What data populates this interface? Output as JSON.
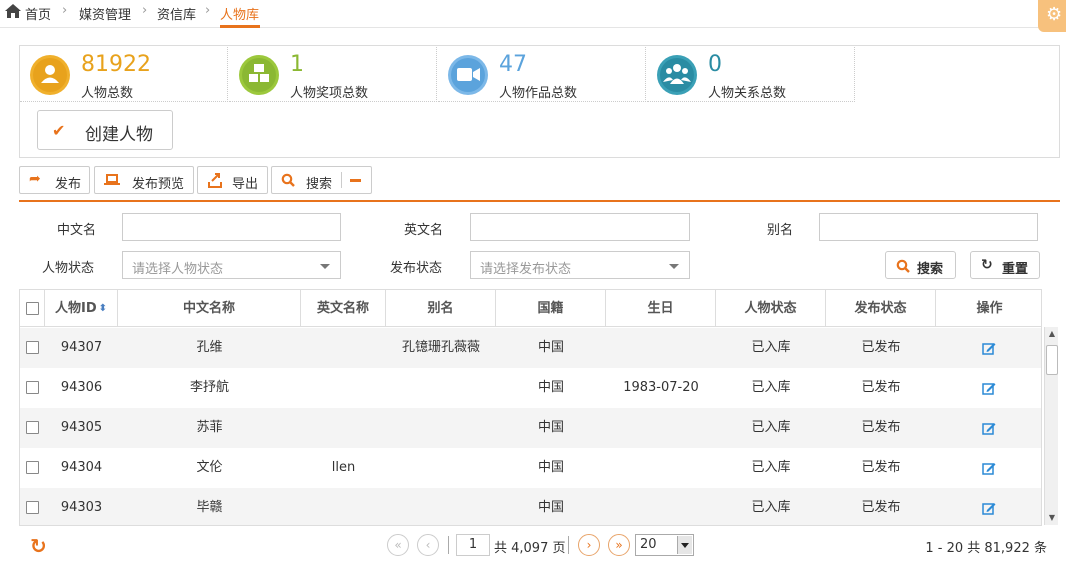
{
  "breadcrumb": {
    "home": "首页",
    "level1": "媒资管理",
    "level2": "资信库",
    "current": "人物库"
  },
  "stats": [
    {
      "value": "81922",
      "label": "人物总数",
      "color": "#e8a21c",
      "icon": "person-icon"
    },
    {
      "value": "1",
      "label": "人物奖项总数",
      "color": "#8bb833",
      "icon": "cubes-icon"
    },
    {
      "value": "47",
      "label": "人物作品总数",
      "color": "#5ba3dc",
      "icon": "video-camera-icon"
    },
    {
      "value": "0",
      "label": "人物关系总数",
      "color": "#2a8ca3",
      "icon": "users-icon"
    }
  ],
  "create_button": "创建人物",
  "toolbar": {
    "publish": "发布",
    "preview": "发布预览",
    "export": "导出",
    "search": "搜索"
  },
  "filters": {
    "chinese_name_label": "中文名",
    "english_name_label": "英文名",
    "alias_label": "别名",
    "person_status_label": "人物状态",
    "person_status_placeholder": "请选择人物状态",
    "publish_status_label": "发布状态",
    "publish_status_placeholder": "请选择发布状态",
    "search_button": "搜索",
    "reset_button": "重置"
  },
  "table": {
    "headers": [
      "人物ID",
      "中文名称",
      "英文名称",
      "别名",
      "国籍",
      "生日",
      "人物状态",
      "发布状态",
      "操作"
    ],
    "rows": [
      {
        "id": "94307",
        "cn_name": "孔维",
        "en_name": "",
        "alias": "孔镱珊孔薇薇",
        "nationality": "中国",
        "birthday": "",
        "person_status": "已入库",
        "publish_status": "已发布"
      },
      {
        "id": "94306",
        "cn_name": "李抒航",
        "en_name": "",
        "alias": "",
        "nationality": "中国",
        "birthday": "1983-07-20",
        "person_status": "已入库",
        "publish_status": "已发布"
      },
      {
        "id": "94305",
        "cn_name": "苏菲",
        "en_name": "",
        "alias": "",
        "nationality": "中国",
        "birthday": "",
        "person_status": "已入库",
        "publish_status": "已发布"
      },
      {
        "id": "94304",
        "cn_name": "文伦",
        "en_name": "llen",
        "alias": "",
        "nationality": "中国",
        "birthday": "",
        "person_status": "已入库",
        "publish_status": "已发布"
      },
      {
        "id": "94303",
        "cn_name": "毕赣",
        "en_name": "",
        "alias": "",
        "nationality": "中国",
        "birthday": "",
        "person_status": "已入库",
        "publish_status": "已发布"
      }
    ]
  },
  "pager": {
    "current_page": "1",
    "total_pages_text": "共 4,097 页",
    "page_size": "20",
    "summary": "1 - 20   共 81,922 条"
  },
  "accent_color": "#e8731c"
}
